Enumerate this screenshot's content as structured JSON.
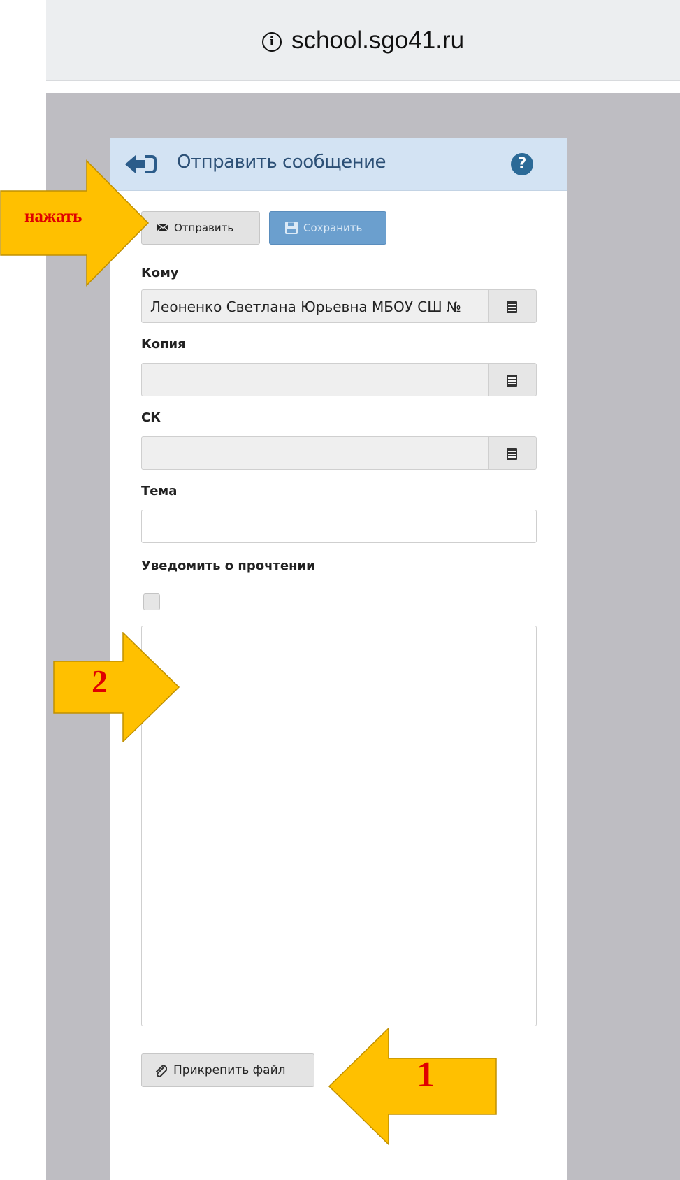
{
  "browser": {
    "url": "school.sgo41.ru"
  },
  "header": {
    "title": "Отправить сообщение"
  },
  "toolbar": {
    "send_label": "Отправить",
    "save_label": "Сохранить"
  },
  "form": {
    "to_label": "Кому",
    "to_value": "Леоненко Светлана Юрьевна МБОУ СШ №",
    "copy_label": "Копия",
    "copy_value": "",
    "bcc_label": "СК",
    "bcc_value": "",
    "subject_label": "Тема",
    "subject_value": "",
    "notify_label": "Уведомить о прочтении",
    "notify_checked": false,
    "body_value": ""
  },
  "attach": {
    "label": "Прикрепить файл"
  },
  "annotations": {
    "press": "нажать",
    "step2": "2",
    "step1": "1",
    "arrow_color": "#ffc000",
    "arrow_text_color": "#e00000"
  }
}
